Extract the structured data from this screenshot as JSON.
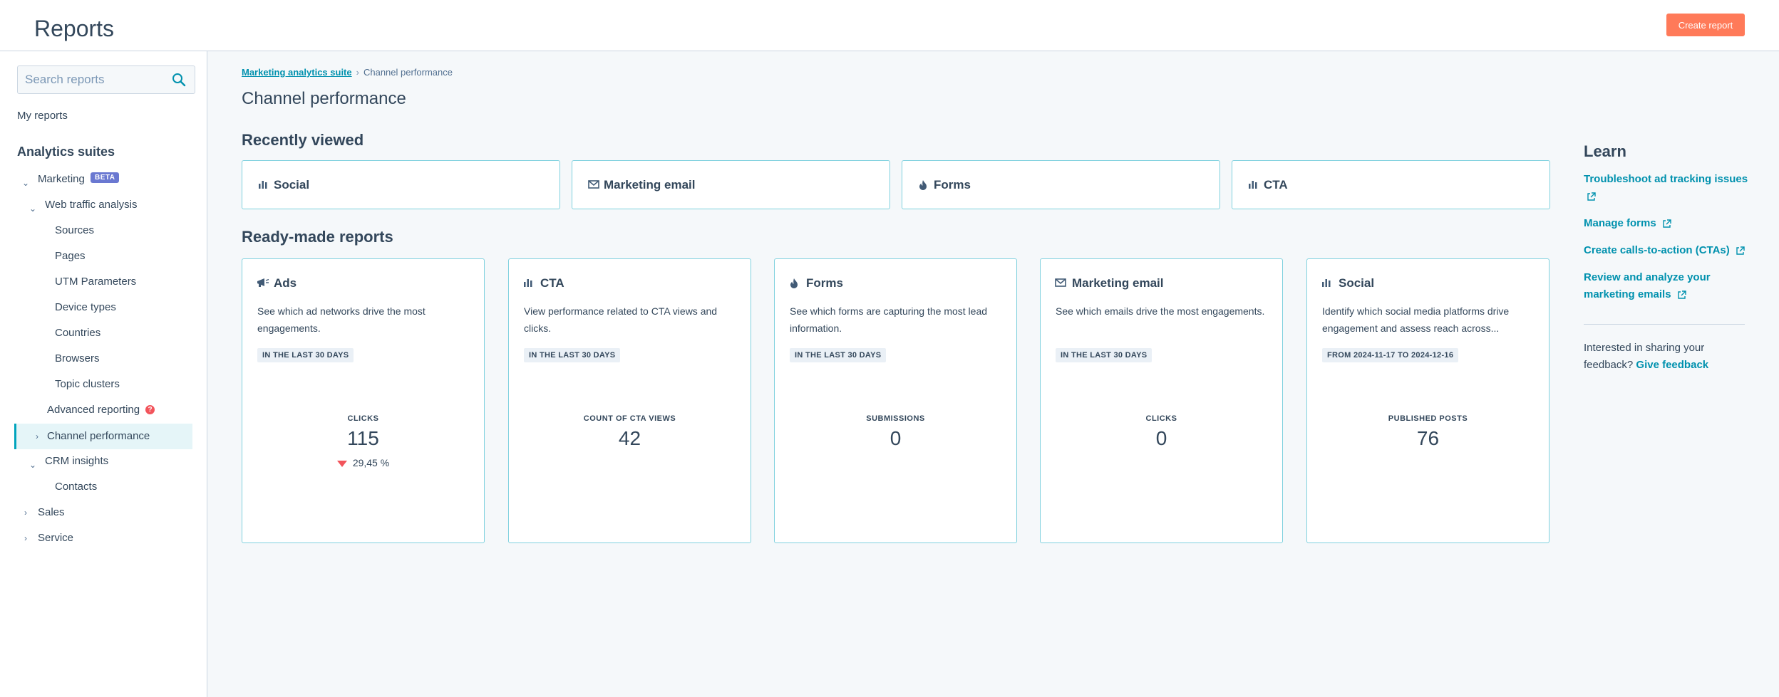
{
  "app": {
    "title": "Reports",
    "create_button": "Create report"
  },
  "sidebar": {
    "search_placeholder": "Search reports",
    "my_reports": "My reports",
    "analytics_heading": "Analytics suites",
    "marketing": "Marketing",
    "beta_badge": "BETA",
    "web_traffic": "Web traffic analysis",
    "web_traffic_items": [
      "Sources",
      "Pages",
      "UTM Parameters",
      "Device types",
      "Countries",
      "Browsers",
      "Topic clusters"
    ],
    "advanced_reporting": "Advanced reporting",
    "channel_performance": "Channel performance",
    "crm_insights": "CRM insights",
    "contacts": "Contacts",
    "sales": "Sales",
    "service": "Service"
  },
  "breadcrumb": {
    "parent": "Marketing analytics suite",
    "current": "Channel performance"
  },
  "page_title": "Channel performance",
  "recently_viewed": {
    "heading": "Recently viewed",
    "items": [
      {
        "label": "Social",
        "icon": "bar-chart-icon"
      },
      {
        "label": "Marketing email",
        "icon": "email-icon"
      },
      {
        "label": "Forms",
        "icon": "flame-icon"
      },
      {
        "label": "CTA",
        "icon": "bar-chart-icon"
      }
    ]
  },
  "ready_made": {
    "heading": "Ready-made reports",
    "cards": [
      {
        "title": "Ads",
        "icon": "megaphone-icon",
        "description": "See which ad networks drive the most engagements.",
        "tag": "IN THE LAST 30 DAYS",
        "metric_label": "CLICKS",
        "metric_value": "115",
        "delta": "29,45 %"
      },
      {
        "title": "CTA",
        "icon": "bar-chart-icon",
        "description": "View performance related to CTA views and clicks.",
        "tag": "IN THE LAST 30 DAYS",
        "metric_label": "COUNT OF CTA VIEWS",
        "metric_value": "42"
      },
      {
        "title": "Forms",
        "icon": "flame-icon",
        "description": "See which forms are capturing the most lead information.",
        "tag": "IN THE LAST 30 DAYS",
        "metric_label": "SUBMISSIONS",
        "metric_value": "0"
      },
      {
        "title": "Marketing email",
        "icon": "email-icon",
        "description": "See which emails drive the most engagements.",
        "tag": "IN THE LAST 30 DAYS",
        "metric_label": "CLICKS",
        "metric_value": "0"
      },
      {
        "title": "Social",
        "icon": "bar-chart-icon",
        "description": "Identify which social media platforms drive engagement and assess reach across...",
        "tag": "FROM 2024-11-17 TO 2024-12-16",
        "metric_label": "PUBLISHED POSTS",
        "metric_value": "76"
      }
    ]
  },
  "learn": {
    "heading": "Learn",
    "links": [
      "Troubleshoot ad tracking issues",
      "Manage forms",
      "Create calls-to-action (CTAs)",
      "Review and analyze your marketing emails"
    ],
    "feedback_text": "Interested in sharing your feedback?",
    "feedback_link": "Give feedback"
  },
  "colors": {
    "accent": "#0091ae",
    "primary_button": "#ff7a59",
    "card_border": "#7fd1de",
    "beta": "#6a78d1",
    "decrease": "#f2545b"
  }
}
